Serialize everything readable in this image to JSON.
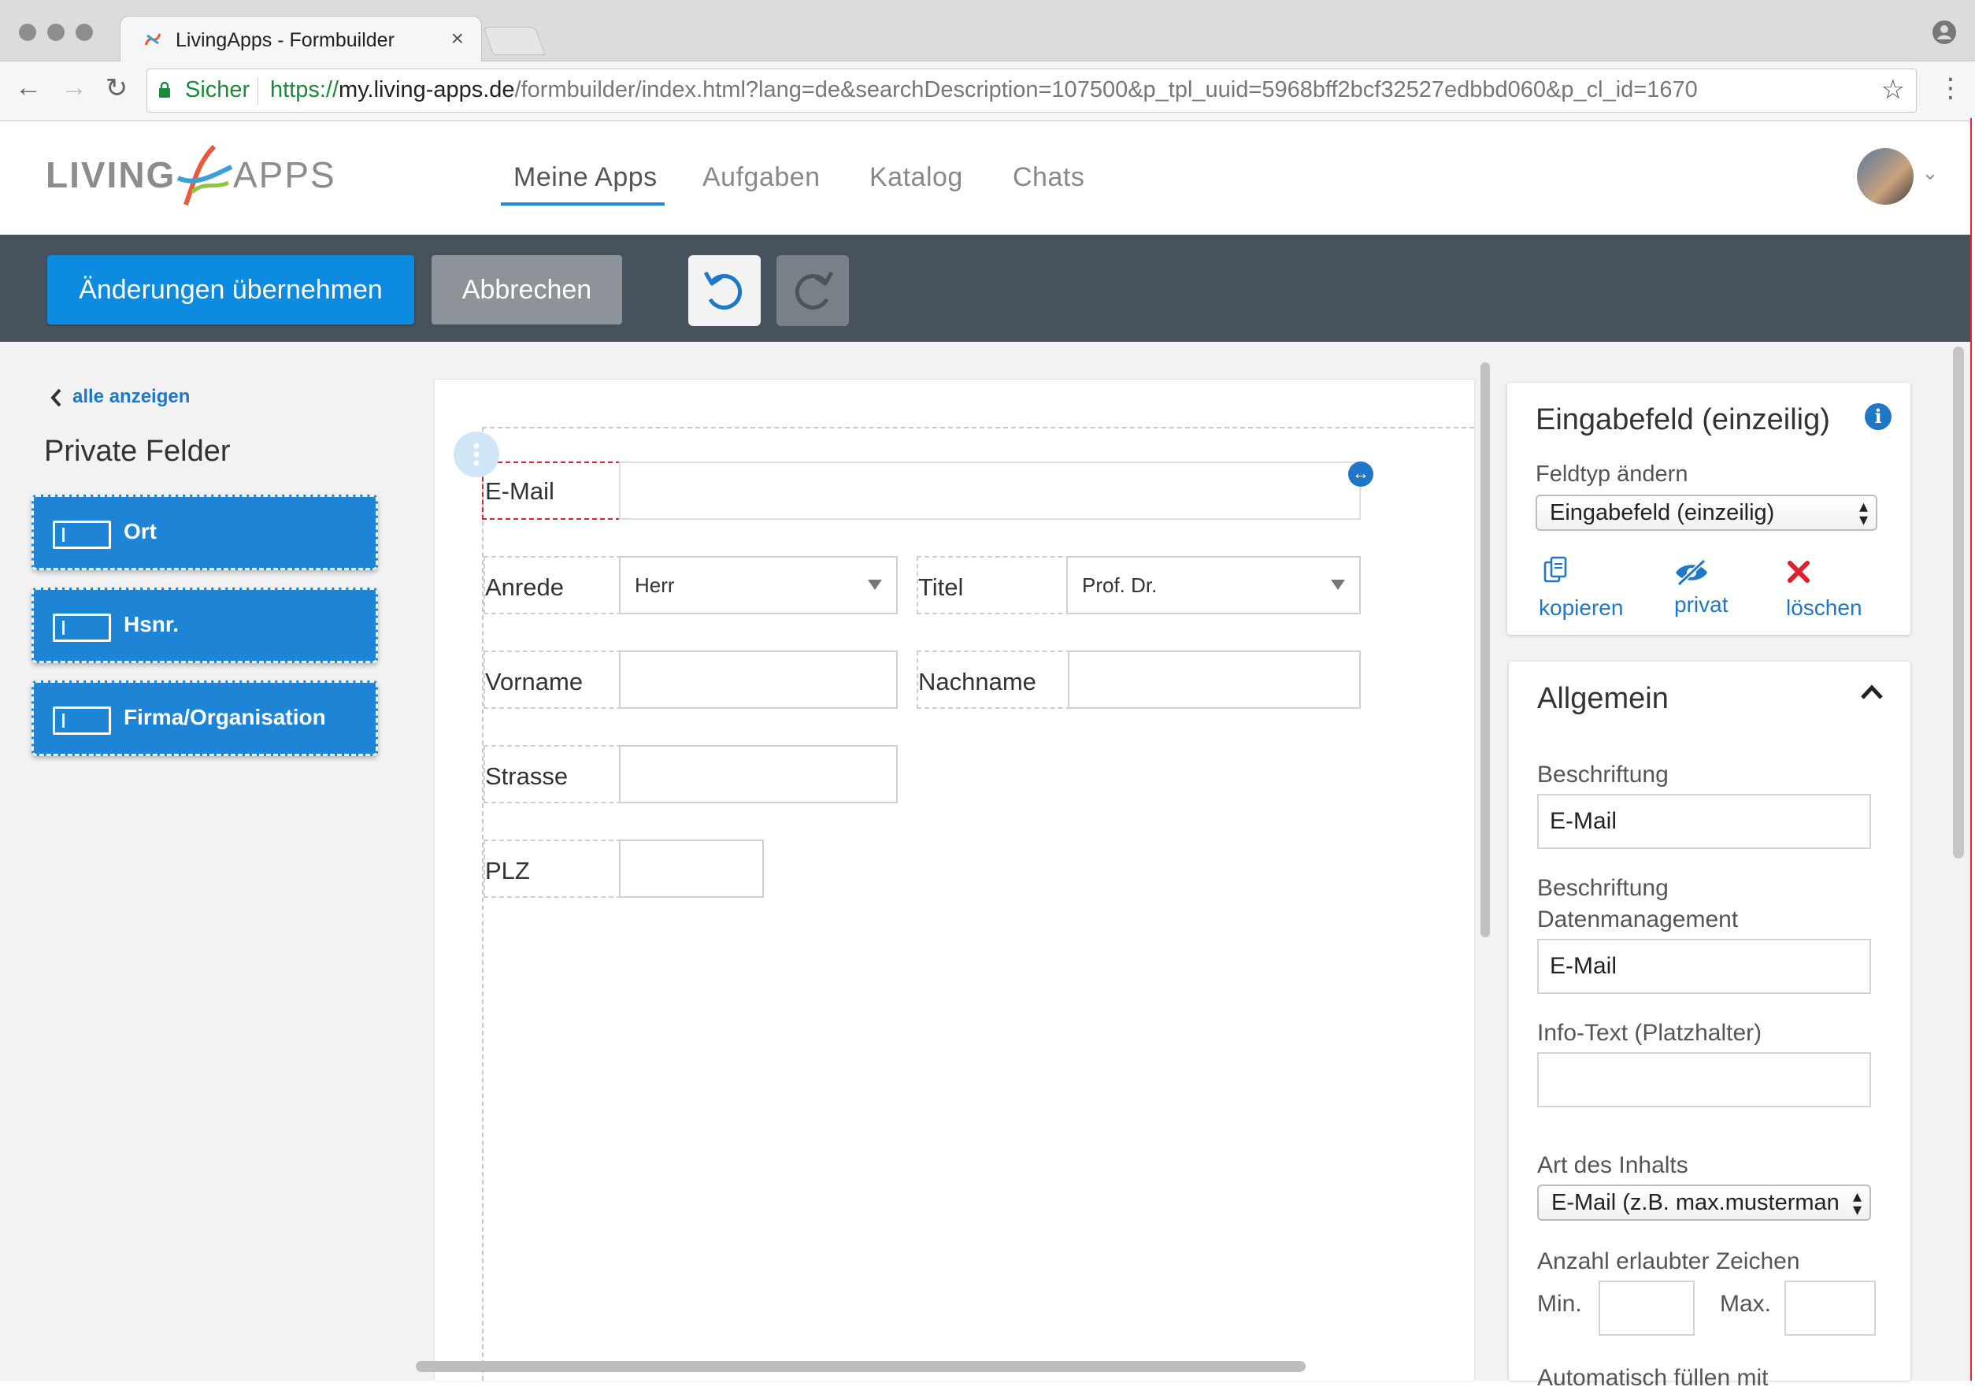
{
  "browser": {
    "tab_title": "LivingApps - Formbuilder",
    "secure_label": "Sicher",
    "url_scheme": "https://",
    "url_host": "my.living-apps.de",
    "url_path": "/formbuilder/index.html?lang=de&searchDescription=107500&p_tpl_uuid=5968bff2bcf32527edbbd060&p_cl_id=1670"
  },
  "nav": {
    "items": [
      "Meine Apps",
      "Aufgaben",
      "Katalog",
      "Chats"
    ],
    "active": "Meine Apps"
  },
  "actions": {
    "apply_label": "Änderungen übernehmen",
    "cancel_label": "Abbrechen"
  },
  "left": {
    "back_label": "alle anzeigen",
    "title": "Private Felder",
    "fields": [
      "Ort",
      "Hsnr.",
      "Firma/Organisation"
    ]
  },
  "form": {
    "email_label": "E-Mail",
    "anrede_label": "Anrede",
    "anrede_value": "Herr",
    "titel_label": "Titel",
    "titel_value": "Prof. Dr.",
    "vorname_label": "Vorname",
    "nachname_label": "Nachname",
    "strasse_label": "Strasse",
    "plz_label": "PLZ"
  },
  "inspector": {
    "type_title": "Eingabefeld (einzeilig)",
    "fieldtype_label": "Feldtyp ändern",
    "fieldtype_value": "Eingabefeld (einzeilig)",
    "copy_label": "kopieren",
    "private_label": "privat",
    "delete_label": "löschen",
    "section_title": "Allgemein",
    "caption_label": "Beschriftung",
    "caption_value": "E-Mail",
    "dm_caption_label_1": "Beschriftung",
    "dm_caption_label_2": "Datenmanagement",
    "dm_caption_value": "E-Mail",
    "placeholder_label": "Info-Text (Platzhalter)",
    "placeholder_value": "",
    "content_type_label": "Art des Inhalts",
    "content_type_value": "E-Mail (z.B. max.musterman",
    "chars_label": "Anzahl erlaubter Zeichen",
    "min_label": "Min.",
    "max_label": "Max.",
    "min_value": "",
    "max_value": "",
    "autofill_label_partial": "Automatisch füllen mit"
  },
  "colors": {
    "primary": "#0d8be0",
    "actionbar": "#46525e",
    "selection": "#e0202a",
    "delete": "#e0202a",
    "link": "#1e77c7",
    "secure": "#1b8a3a"
  },
  "icons": [
    "back-arrow-icon",
    "forward-arrow-icon",
    "reload-icon",
    "lock-icon",
    "star-icon",
    "menu-icon",
    "profile-icon",
    "undo-icon",
    "redo-icon",
    "chevron-left-icon",
    "field-icon",
    "drag-handle-icon",
    "resize-icon",
    "info-icon",
    "copy-icon",
    "eye-slash-icon",
    "delete-icon",
    "chevron-up-icon",
    "select-arrows-icon"
  ]
}
